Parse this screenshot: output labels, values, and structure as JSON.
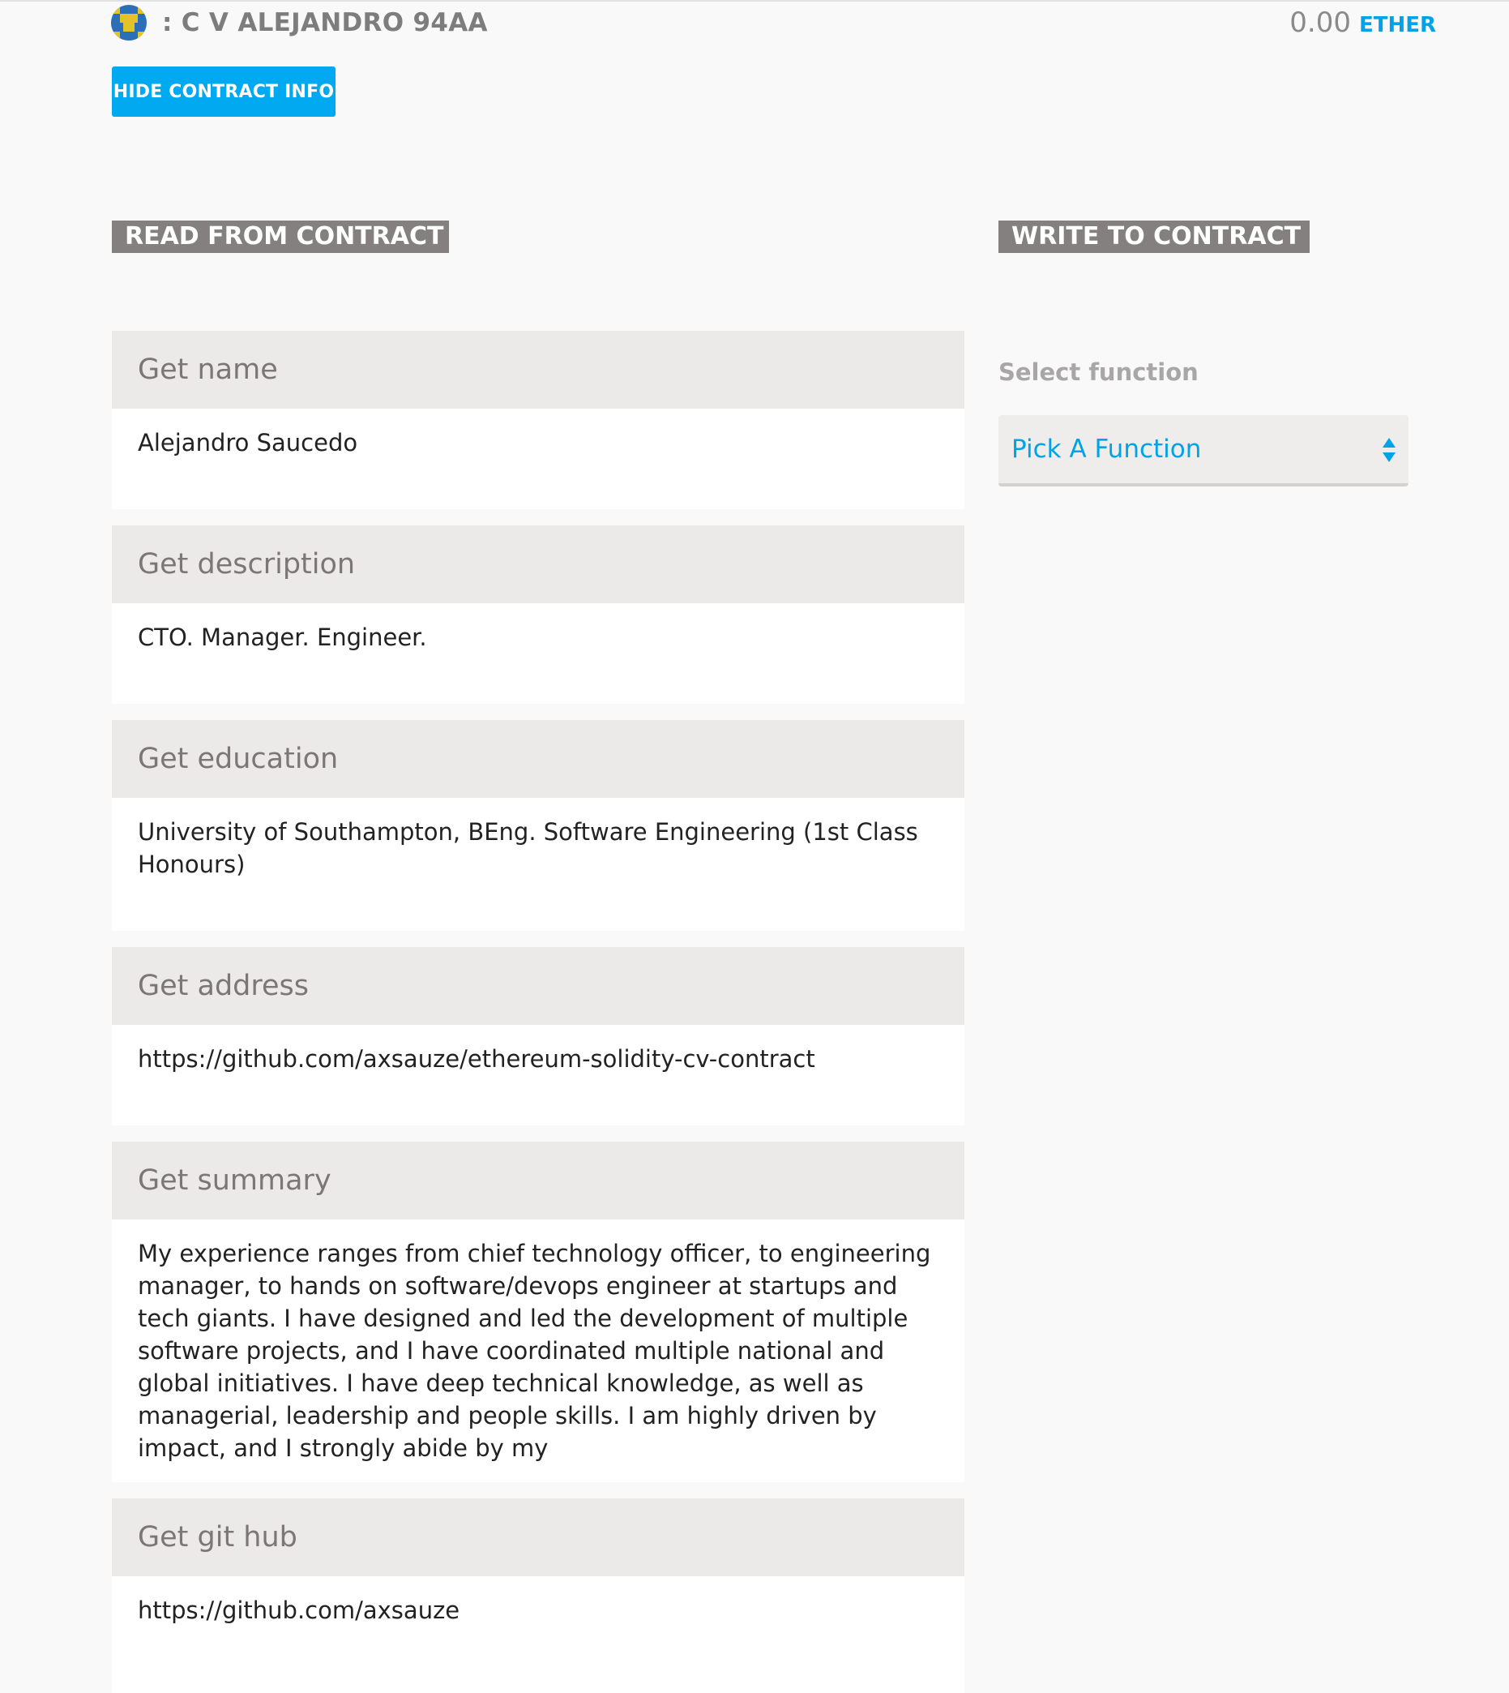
{
  "header": {
    "contract_name": ": C V ALEJANDRO 94AA",
    "balance_amount": "0.00",
    "balance_unit": "ETHER",
    "hide_button_label": "HIDE CONTRACT INFO"
  },
  "read": {
    "heading": "READ FROM CONTRACT",
    "functions": [
      {
        "label": "Get name",
        "value": "Alejandro Saucedo"
      },
      {
        "label": "Get description",
        "value": "CTO. Manager. Engineer."
      },
      {
        "label": "Get education",
        "value": "University of Southampton, BEng. Software Engineering (1st Class Honours)"
      },
      {
        "label": "Get address",
        "value": "https://github.com/axsauze/ethereum-solidity-cv-contract"
      },
      {
        "label": "Get summary",
        "value": "My experience ranges from chief technology officer, to engineering manager, to hands on software/devops engineer at startups and tech giants. I have designed and led the development of multiple software projects, and I have coordinated multiple national and global initiatives. I have deep technical knowledge, as well as managerial, leadership and people skills. I am highly driven by impact, and I strongly abide by my"
      },
      {
        "label": "Get git hub",
        "value": "https://github.com/axsauze"
      }
    ]
  },
  "write": {
    "heading": "WRITE TO CONTRACT",
    "select_label": "Select function",
    "select_value": "Pick A Function"
  },
  "colors": {
    "accent": "#00a9f0",
    "heading_bg": "#858080",
    "card_header_bg": "#ece9e9",
    "page_bg": "#f9f9f9"
  },
  "icons": {
    "contract": "identicon-icon",
    "select_arrows": "select-arrows-icon"
  }
}
